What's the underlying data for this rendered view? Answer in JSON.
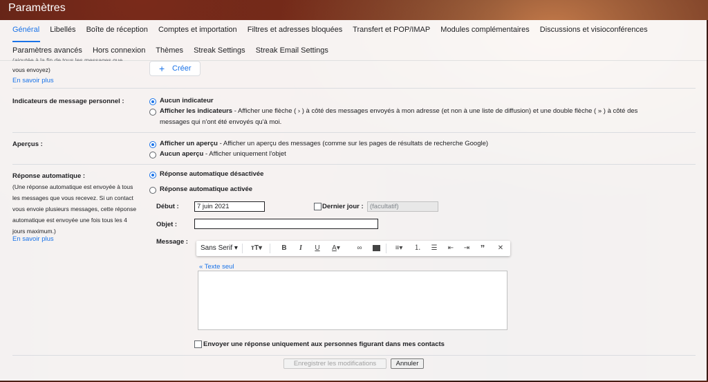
{
  "window": {
    "title": "Paramètres"
  },
  "tabs_row1": [
    "Général",
    "Libellés",
    "Boîte de réception",
    "Comptes et importation",
    "Filtres et adresses bloquées",
    "Transfert et POP/IMAP",
    "Modules complémentaires",
    "Discussions et visioconférences"
  ],
  "tabs_row2": [
    "Paramètres avancés",
    "Hors connexion",
    "Thèmes",
    "Streak Settings",
    "Streak Email Settings"
  ],
  "signature": {
    "cut_text_1": "(ajoutée à la fin de tous les messages que",
    "cut_text_2": "vous envoyez)",
    "learn_more": "En savoir plus",
    "create_button": "Créer"
  },
  "indicators": {
    "label": "Indicateurs de message personnel :",
    "option1": "Aucun indicateur",
    "option2_bold": "Afficher les indicateurs",
    "option2_text": " - Afficher une flèche ( › ) à côté des messages envoyés à mon adresse (et non à une liste de diffusion) et une double flèche ( » ) à côté des",
    "option2_text2": "messages qui n'ont été envoyés qu'à moi."
  },
  "previews": {
    "label": "Aperçus :",
    "option1_bold": "Afficher un aperçu",
    "option1_text": " - Afficher un aperçu des messages (comme sur les pages de résultats de recherche Google)",
    "option2_bold": "Aucun aperçu",
    "option2_text": " - Afficher uniquement l'objet"
  },
  "auto_reply": {
    "label": "Réponse automatique :",
    "desc": [
      "(Une réponse automatique est envoyée à tous",
      "les messages que vous recevez. Si un contact",
      "vous envoie plusieurs messages, cette réponse",
      "automatique est envoyée une fois tous les 4",
      "jours maximum.)"
    ],
    "learn_more": "En savoir plus",
    "off": "Réponse automatique désactivée",
    "on": "Réponse automatique activée",
    "start_label": "Début :",
    "start_value": "7 juin 2021",
    "last_day_label": "Dernier jour :",
    "last_day_placeholder": "(facultatif)",
    "subject_label": "Objet :",
    "subject_value": "",
    "message_label": "Message :",
    "font_name": "Sans Serif",
    "plain_text_link": "« Texte seul",
    "contacts_only": "Envoyer une réponse uniquement aux personnes figurant dans mes contacts"
  },
  "footer": {
    "save": "Enregistrer les modifications",
    "cancel": "Annuler"
  },
  "colors": {
    "accent": "#1a73e8",
    "title_bg": "#3a1a14"
  }
}
